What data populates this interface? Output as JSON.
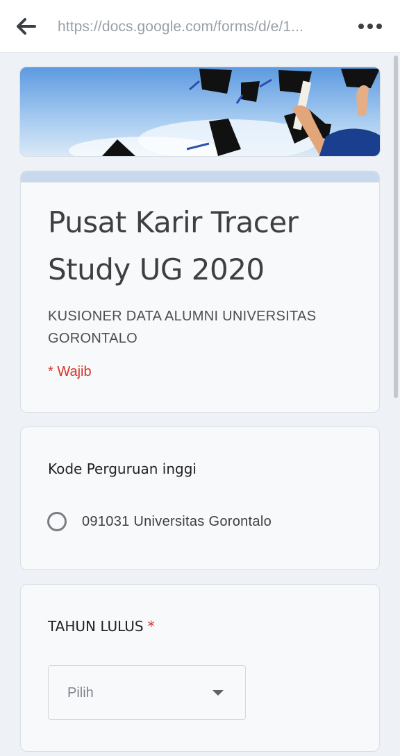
{
  "browser": {
    "url": "https://docs.google.com/forms/d/e/1...",
    "back_icon": "arrow-left-icon",
    "menu_icon": "more-horizontal-icon"
  },
  "form": {
    "title": "Pusat Karir Tracer Study UG 2020",
    "description": "KUSIONER DATA ALUMNI UNIVERSITAS GORONTALO",
    "required_note": "* Wajib",
    "accent_color": "#c8d9ee",
    "required_color": "#d93025"
  },
  "questions": [
    {
      "label": "Kode Perguruan inggi",
      "type": "radio",
      "options": [
        "091031 Universitas Gorontalo"
      ]
    },
    {
      "label": "TAHUN LULUS",
      "required_mark": "*",
      "type": "dropdown",
      "placeholder": "Pilih"
    }
  ]
}
